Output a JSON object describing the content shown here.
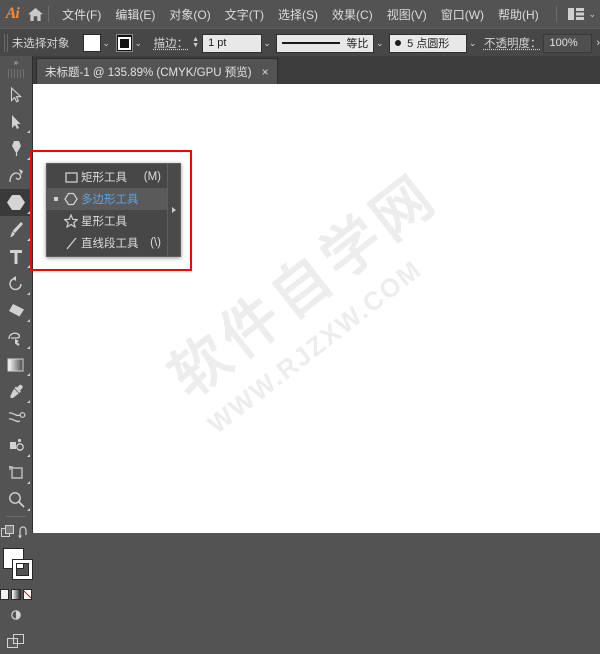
{
  "app": {
    "name": "Ai",
    "home_icon": "home-icon",
    "workspace_icon": "workspace-switcher-icon",
    "caret": "⌄"
  },
  "menubar": {
    "items": [
      {
        "label": "文件(F)"
      },
      {
        "label": "编辑(E)"
      },
      {
        "label": "对象(O)"
      },
      {
        "label": "文字(T)"
      },
      {
        "label": "选择(S)"
      },
      {
        "label": "效果(C)"
      },
      {
        "label": "视图(V)"
      },
      {
        "label": "窗口(W)"
      },
      {
        "label": "帮助(H)"
      }
    ]
  },
  "controlbar": {
    "selection_status": "未选择对象",
    "fill_swatch": "#ffffff",
    "stroke_swatch": "#000000",
    "stroke_label": "描边：",
    "stroke_weight": "1 pt",
    "profile_label": "等比",
    "brush_label": "5 点圆形",
    "opacity_label": "不透明度：",
    "opacity_value": "100%",
    "more_arrow": "›",
    "caret": "⌄"
  },
  "tabbar": {
    "document_title": "未标题-1 @ 135.89% (CMYK/GPU 预览)",
    "close_label": "×"
  },
  "toolbar": {
    "collapse_handle": "»",
    "tools": [
      {
        "name": "selection-tool",
        "has_flyout": false
      },
      {
        "name": "direct-selection-tool",
        "has_flyout": true
      },
      {
        "name": "pen-tool",
        "has_flyout": true
      },
      {
        "name": "curvature-tool",
        "has_flyout": false
      },
      {
        "name": "shape-tool",
        "has_flyout": true,
        "active": true
      },
      {
        "name": "paintbrush-tool",
        "has_flyout": true
      },
      {
        "name": "type-tool",
        "has_flyout": true
      },
      {
        "name": "rotate-tool",
        "has_flyout": true
      },
      {
        "name": "eraser-tool",
        "has_flyout": true
      },
      {
        "name": "shape-builder-tool",
        "has_flyout": true
      },
      {
        "name": "gradient-tool",
        "has_flyout": true
      },
      {
        "name": "eyedropper-tool",
        "has_flyout": true
      },
      {
        "name": "blend-tool",
        "has_flyout": false
      },
      {
        "name": "symbol-sprayer-tool",
        "has_flyout": true
      },
      {
        "name": "artboard-tool",
        "has_flyout": true
      },
      {
        "name": "zoom-tool",
        "has_flyout": true
      },
      {
        "name": "edit-toolbar-button",
        "has_flyout": false
      },
      {
        "name": "change-screen-mode-button",
        "has_flyout": false
      }
    ],
    "fill_color": "#ffffff",
    "stroke_color": "#000000",
    "color_modes": [
      "color",
      "gradient",
      "none"
    ],
    "screen_mode": "screen-mode-icon"
  },
  "flyout_menu": {
    "items": [
      {
        "icon": "rectangle-icon",
        "label": "矩形工具",
        "shortcut": "(M)",
        "selected": false,
        "highlighted": false
      },
      {
        "icon": "polygon-icon",
        "label": "多边形工具",
        "shortcut": "",
        "selected": true,
        "highlighted": true
      },
      {
        "icon": "star-icon",
        "label": "星形工具",
        "shortcut": "",
        "selected": false,
        "highlighted": false
      },
      {
        "icon": "line-segment-icon",
        "label": "直线段工具",
        "shortcut": "(\\)",
        "selected": false,
        "highlighted": false
      }
    ],
    "tearoff_arrow": "tear-off-arrow-icon"
  },
  "canvas": {
    "watermark_cn": "软件自学网",
    "watermark_en": "WWW.RJZXW.COM"
  },
  "annotation": {
    "highlight_color": "#ff0000"
  }
}
